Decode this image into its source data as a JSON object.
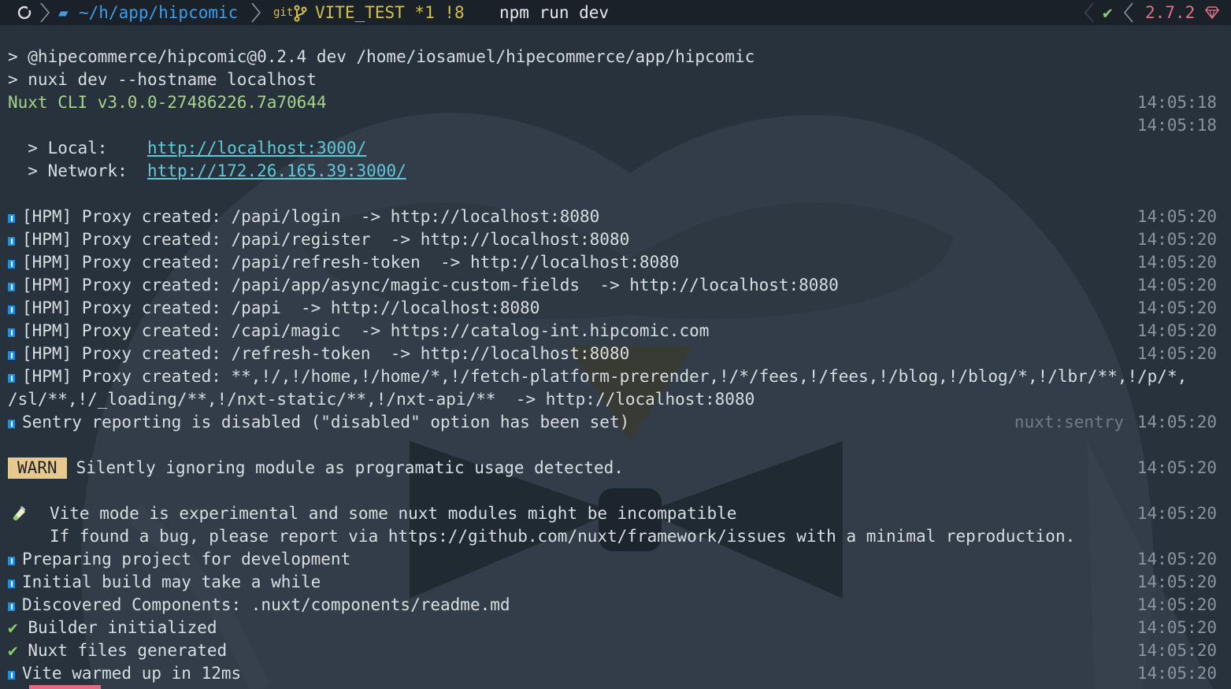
{
  "prompt": {
    "path": "~/h/app/hipcomic",
    "git_label": "git",
    "branch": "VITE_TEST *1 !8",
    "command": "npm run dev",
    "status_check": "✔",
    "version": "2.7.2"
  },
  "lines": {
    "l1": "> @hipecommerce/hipcomic@0.2.4 dev /home/iosamuel/hipecommerce/app/hipcomic",
    "l2": "> nuxi dev --hostname localhost",
    "l3": "Nuxt CLI v3.0.0-27486226.7a70644",
    "l3_ts": "14:05:18",
    "l4_ts": "14:05:18",
    "local_label": "  > Local:    ",
    "local_url": "http://localhost:3000/",
    "network_label": "  > Network:  ",
    "network_url": "http://172.26.165.39:3000/",
    "p1": "[HPM] Proxy created: /papi/login  -> http://localhost:8080",
    "p2": "[HPM] Proxy created: /papi/register  -> http://localhost:8080",
    "p3": "[HPM] Proxy created: /papi/refresh-token  -> http://localhost:8080",
    "p4": "[HPM] Proxy created: /papi/app/async/magic-custom-fields  -> http://localhost:8080",
    "p5": "[HPM] Proxy created: /papi  -> http://localhost:8080",
    "p6": "[HPM] Proxy created: /capi/magic  -> https://catalog-int.hipcomic.com",
    "p7": "[HPM] Proxy created: /refresh-token  -> http://localhost:8080",
    "p8a": "[HPM] Proxy created: **,!/,!/home,!/home/*,!/fetch-platform-prerender,!/*/fees,!/fees,!/blog,!/blog/*,!/lbr/**,!/p/*,",
    "p8b": "/sl/**,!/_loading/**,!/nxt-static/**,!/nxt-api/**  -> http://localhost:8080",
    "ts20": "14:05:20",
    "sentry": "Sentry reporting is disabled (\"disabled\" option has been set)",
    "sentry_tag": "nuxt:sentry",
    "warn_badge": "WARN",
    "warn_msg": "Silently ignoring module as programatic usage detected.",
    "vite1": "Vite mode is experimental and some nuxt modules might be incompatible",
    "vite2": "If found a bug, please report via https://github.com/nuxt/framework/issues with a minimal reproduction.",
    "prep": "Preparing project for development",
    "initial": "Initial build may take a while",
    "discovered": "Discovered Components: .nuxt/components/readme.md",
    "builder": "Builder initialized",
    "nuxtfiles": "Nuxt files generated",
    "warmed": "Vite warmed up in 12ms",
    "check": "✔"
  },
  "colors": {
    "background": "#27323d",
    "prompt_bg": "#1a2129",
    "path": "#3e9de8",
    "branch": "#d3c24a",
    "success": "#8bd06a",
    "version": "#e0708a",
    "link": "#5ec9d8",
    "warn_badge": "#e8c98d",
    "info_icon": "#1d8fe0"
  }
}
